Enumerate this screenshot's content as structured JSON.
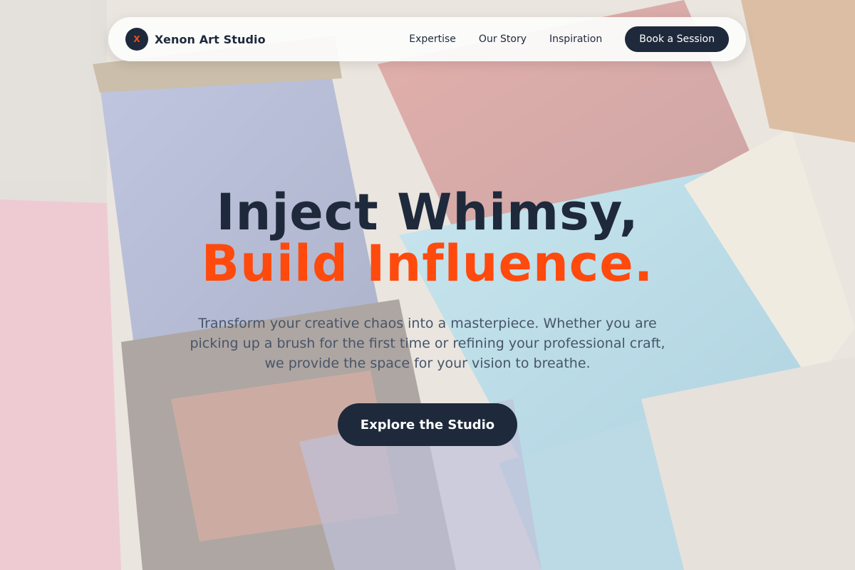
{
  "brand": {
    "mark": "X",
    "name": "Xenon Art Studio"
  },
  "nav": {
    "links": [
      "Expertise",
      "Our Story",
      "Inspiration"
    ],
    "cta_label": "Book a Session"
  },
  "hero": {
    "headline_line1": "Inject Whimsy,",
    "headline_line2": "Build Influence.",
    "subtext": "Transform your creative chaos into a masterpiece. Whether you are picking up a brush for the first time or refining your professional craft, we provide the space for your vision to breathe.",
    "cta_label": "Explore the Studio"
  },
  "colors": {
    "navy": "#1e293b",
    "accent_orange": "#ff4a0e",
    "body_text": "#475569"
  }
}
